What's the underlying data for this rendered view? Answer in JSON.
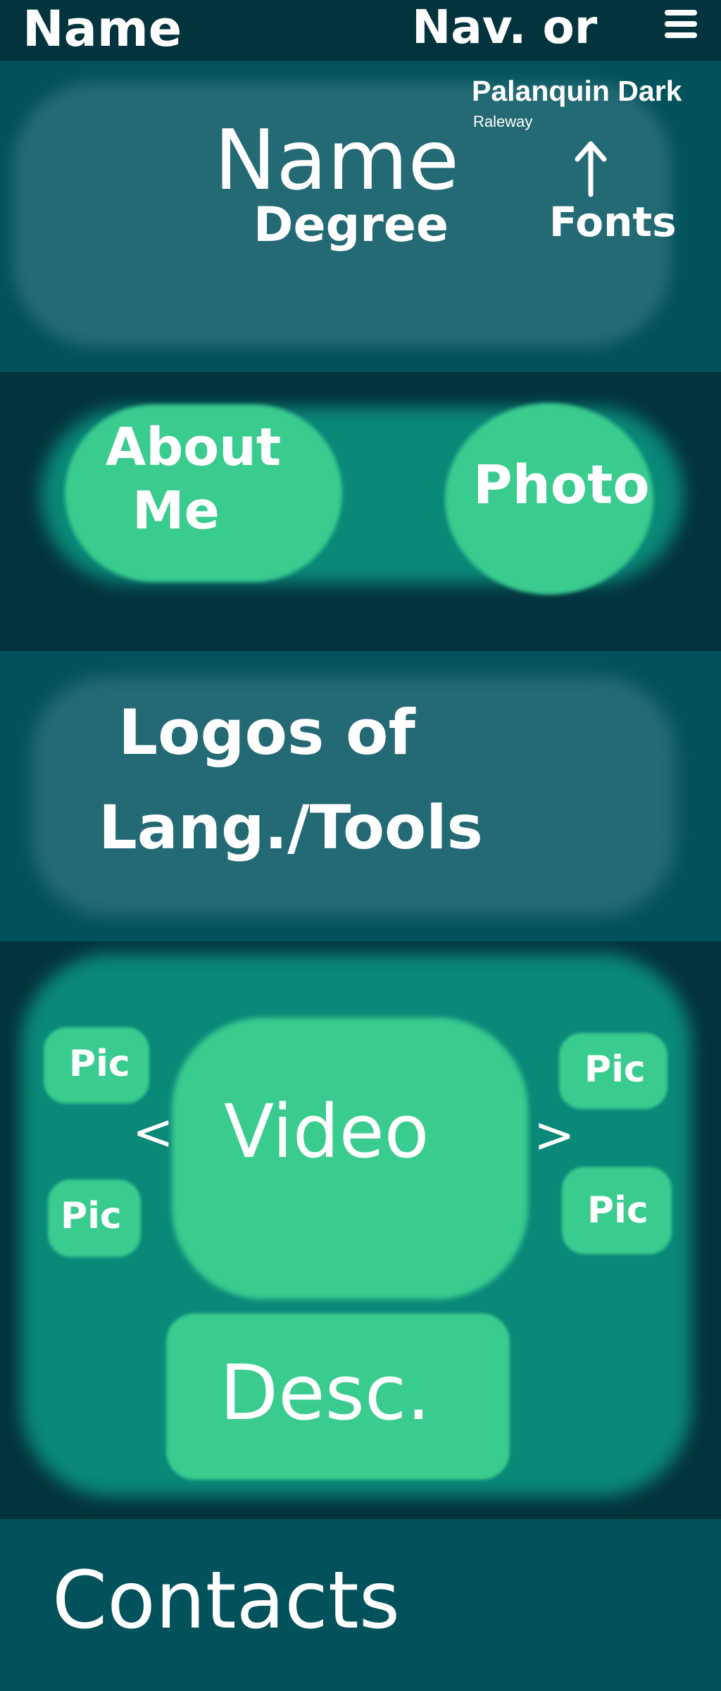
{
  "header": {
    "name": "Name",
    "nav_label": "Nav. or",
    "menu_icon": "hamburger-menu-icon"
  },
  "hero": {
    "name": "Name",
    "degree": "Degree",
    "font_primary": "Palanquin Dark",
    "font_secondary": "Raleway",
    "fonts_label": "Fonts"
  },
  "about": {
    "about_line1": "About",
    "about_line2": "Me",
    "photo": "Photo"
  },
  "skills": {
    "line1": "Logos of",
    "line2": "Lang./Tools"
  },
  "projects": {
    "pic_top_left": "Pic",
    "pic_bottom_left": "Pic",
    "pic_top_right": "Pic",
    "pic_bottom_right": "Pic",
    "prev": "<",
    "next": ">",
    "video": "Video",
    "desc": "Desc."
  },
  "contacts": {
    "label": "Contacts"
  },
  "colors": {
    "dark_band": "#03343d",
    "mid_band": "#02525b",
    "card_slate": "#246a75",
    "card_teal": "#0a8878",
    "accent_green": "#3acb8f",
    "text": "#ffffff"
  }
}
